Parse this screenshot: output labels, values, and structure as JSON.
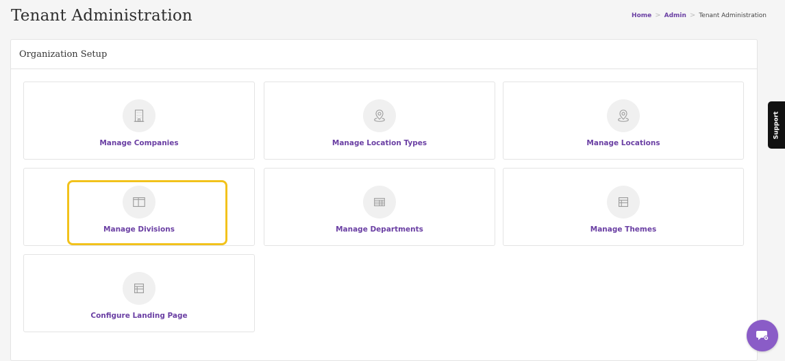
{
  "header": {
    "title": "Tenant Administration",
    "breadcrumb": {
      "home": "Home",
      "admin": "Admin",
      "current": "Tenant Administration",
      "separator": ">"
    }
  },
  "card": {
    "title": "Organization Setup"
  },
  "tiles": [
    {
      "label": "Manage Companies",
      "icon": "building-icon"
    },
    {
      "label": "Manage Location Types",
      "icon": "location-pin-icon"
    },
    {
      "label": "Manage Locations",
      "icon": "location-pin-icon"
    },
    {
      "label": "Manage Divisions",
      "icon": "columns-icon"
    },
    {
      "label": "Manage Departments",
      "icon": "grid-table-icon"
    },
    {
      "label": "Manage Themes",
      "icon": "layout-icon"
    },
    {
      "label": "Configure Landing Page",
      "icon": "layout-icon"
    }
  ],
  "support": {
    "label": "Support"
  },
  "colors": {
    "accent": "#6a3fa3",
    "highlight": "#f2c21b",
    "chat": "#8a5cc7"
  }
}
